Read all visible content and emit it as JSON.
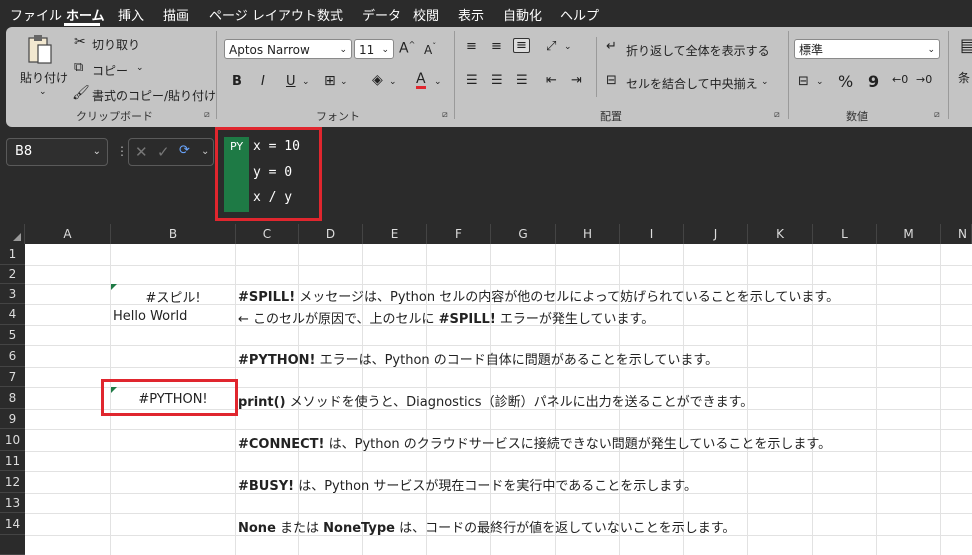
{
  "menu": {
    "tabs": [
      "ファイル",
      "ホーム",
      "挿入",
      "描画",
      "ページ レイアウト",
      "数式",
      "データ",
      "校閲",
      "表示",
      "自動化",
      "ヘルプ"
    ],
    "active": "ホーム"
  },
  "ribbon": {
    "clipboard": {
      "paste": "貼り付け",
      "cut": "切り取り",
      "copy": "コピー",
      "format_painter": "書式のコピー/貼り付け",
      "label": "クリップボード"
    },
    "font": {
      "font_name": "Aptos Narrow",
      "font_size": "11",
      "bold": "B",
      "italic": "I",
      "underline": "U",
      "font_color": "A",
      "grow": "A",
      "shrink": "A",
      "label": "フォント"
    },
    "alignment": {
      "wrap_text": "折り返して全体を表示する",
      "merge_center": "セルを結合して中央揃え",
      "label": "配置"
    },
    "number": {
      "format": "標準",
      "percent": "%",
      "comma": "9",
      "label": "数値",
      "conditional_partial": "条"
    }
  },
  "formula_bar": {
    "name_box": "B8",
    "py_badge": "PY",
    "code_lines": [
      "x = 10",
      "y = 0",
      "x / y"
    ]
  },
  "grid": {
    "columns": [
      "A",
      "B",
      "C",
      "D",
      "E",
      "F",
      "G",
      "H",
      "I",
      "J",
      "K",
      "L",
      "M",
      "N"
    ],
    "rows": [
      "1",
      "2",
      "3",
      "4",
      "5",
      "6",
      "7",
      "8",
      "9",
      "10",
      "11",
      "12",
      "13",
      "14"
    ],
    "cells": {
      "B3": "#スピル!",
      "B4": "Hello World",
      "B8": "#PYTHON!",
      "C3_bold": "#SPILL!",
      "C3_text": " メッセージは、Python セルの内容が他のセルによって妨げられていることを示しています。",
      "C4_text1": "← このセルが原因で、上のセルに ",
      "C4_bold": "#SPILL!",
      "C4_text2": " エラーが発生しています。",
      "C6_bold": "#PYTHON!",
      "C6_text": " エラーは、Python のコード自体に問題があることを示しています。",
      "C8_bold": "print()",
      "C8_text": " メソッドを使うと、Diagnostics（診断）パネルに出力を送ることができます。",
      "C10_bold": "#CONNECT!",
      "C10_text": " は、Python のクラウドサービスに接続できない問題が発生していることを示します。",
      "C12_bold": "#BUSY!",
      "C12_text": " は、Python サービスが現在コードを実行中であることを示します。",
      "C14_bold1": "None",
      "C14_text1": " または ",
      "C14_bold2": "NoneType",
      "C14_text2": " は、コードの最終行が値を返していないことを示します。"
    }
  },
  "colors": {
    "dark_bg": "#2b2b2b",
    "ribbon_bg": "#c4c4c4",
    "python_green": "#1e7a45",
    "highlight_red": "#e0262e"
  }
}
